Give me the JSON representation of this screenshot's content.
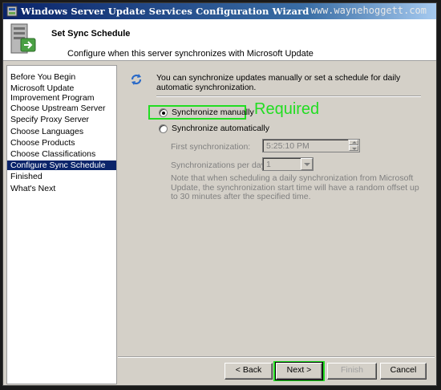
{
  "window": {
    "title": "Windows Server Update Services Configuration Wizard",
    "watermark": "www.waynehoggett.com"
  },
  "header": {
    "title": "Set Sync Schedule",
    "subtitle": "Configure when this server synchronizes with Microsoft Update"
  },
  "nav": {
    "items": [
      {
        "label": "Before You Begin"
      },
      {
        "label": "Microsoft Update Improvement Program"
      },
      {
        "label": "Choose Upstream Server"
      },
      {
        "label": "Specify Proxy Server"
      },
      {
        "label": "Choose Languages"
      },
      {
        "label": "Choose Products"
      },
      {
        "label": "Choose Classifications"
      },
      {
        "label": "Configure Sync Schedule",
        "selected": true
      },
      {
        "label": "Finished"
      },
      {
        "label": "What's Next"
      }
    ]
  },
  "main": {
    "intro": "You can synchronize updates manually or set a schedule for daily automatic synchronization.",
    "manual_label": "Synchronize manually",
    "manual_selected": true,
    "auto_label": "Synchronize automatically",
    "first_sync_label": "First synchronization:",
    "first_sync_value": "5:25:10 PM",
    "per_day_label": "Synchronizations per day:",
    "per_day_value": "1",
    "note": "Note that when scheduling a daily synchronization from Microsoft Update, the synchronization start time will have a random offset up to 30 minutes after the specified time.",
    "annotation": "Required",
    "annotation_color": "#22dd22"
  },
  "footer": {
    "back_label": "< Back",
    "next_label": "Next >",
    "finish_label": "Finish",
    "cancel_label": "Cancel"
  },
  "colors": {
    "titlebar": "#0a246a",
    "selection": "#0a246a",
    "highlight": "#22dd22",
    "dialog": "#d4d0c8"
  }
}
